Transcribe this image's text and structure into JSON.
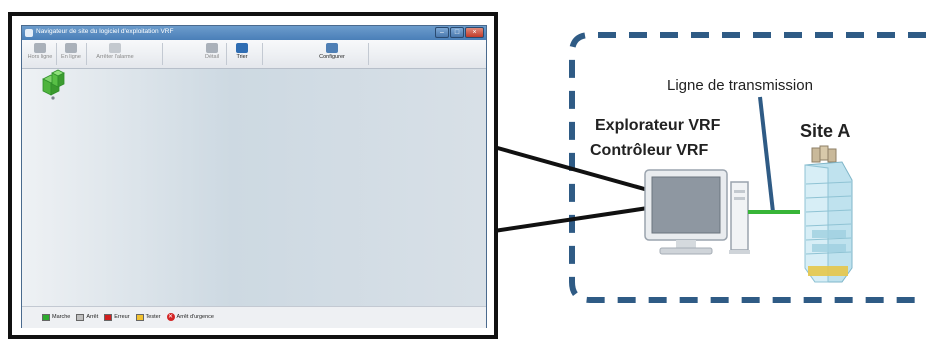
{
  "window": {
    "title": "Navigateur de site du logiciel d'exploitation VRF",
    "controls": {
      "minimize": "–",
      "maximize": "□",
      "close": "×"
    }
  },
  "toolbar": {
    "items": [
      {
        "label": "Hors ligne",
        "icon": "offline-icon",
        "enabled": false
      },
      {
        "label": "En ligne",
        "icon": "online-icon",
        "enabled": false
      },
      {
        "label": "Arrêter l'alarme",
        "icon": "stop-alarm-icon",
        "enabled": false
      },
      {
        "label": "Détail",
        "icon": "detail-icon",
        "enabled": false
      },
      {
        "label": "Trier",
        "icon": "sort-icon",
        "enabled": true
      },
      {
        "label": "Configurer",
        "icon": "configure-icon",
        "enabled": true
      }
    ]
  },
  "workspace": {
    "site_icon": "site-building-icon"
  },
  "status_legend": [
    {
      "label": "Marche",
      "color": "#2eaa2e"
    },
    {
      "label": "Arrêt",
      "color": "#bfbfbf"
    },
    {
      "label": "Erreur",
      "color": "#d01f1f"
    },
    {
      "label": "Tester",
      "color": "#f2c230"
    },
    {
      "label": "Arrêt d'urgence",
      "color": "#d32424",
      "icon": "emergency-stop-icon"
    }
  ],
  "diagram": {
    "transmission_line_label": "Ligne de transmission",
    "controller_line1": "Explorateur VRF",
    "controller_line2": "Contrôleur VRF",
    "site_label": "Site A",
    "colors": {
      "dashed_border": "#2f5b85",
      "transmission_line": "#38b538",
      "pointer_line": "#2f5b85",
      "frame": "#111111"
    }
  }
}
